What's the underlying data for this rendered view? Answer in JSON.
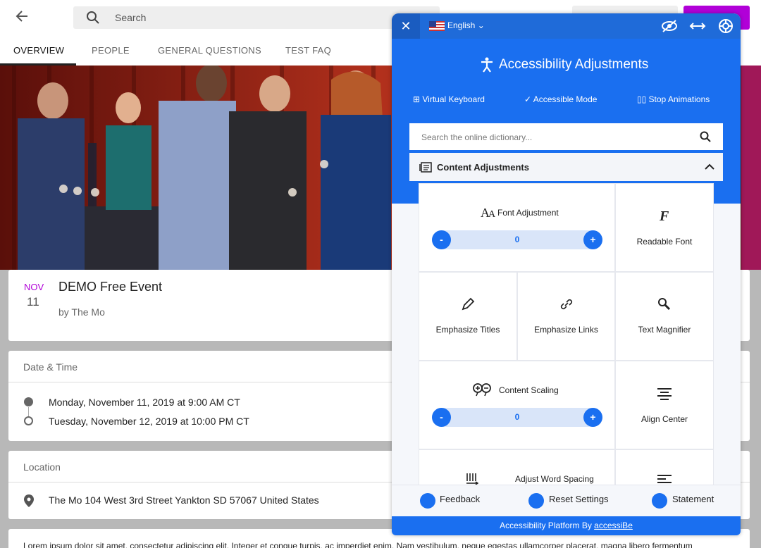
{
  "header": {
    "search_placeholder": "Search"
  },
  "tabs": [
    {
      "label": "OVERVIEW"
    },
    {
      "label": "PEOPLE"
    },
    {
      "label": "GENERAL QUESTIONS"
    },
    {
      "label": "TEST FAQ"
    }
  ],
  "event": {
    "month": "NOV",
    "day": "11",
    "title": "DEMO Free Event",
    "by": "by The Mo"
  },
  "date_time": {
    "heading": "Date & Time",
    "start": "Monday, November 11, 2019 at 9:00 AM CT",
    "end": "Tuesday, November 12, 2019 at 10:00 PM CT"
  },
  "location": {
    "heading": "Location",
    "address": "The Mo 104 West 3rd Street Yankton SD 57067 United States"
  },
  "description": {
    "text": "Lorem ipsum dolor sit amet, consectetur adipiscing elit. Integer et congue turpis, ac imperdiet enim. Nam vestibulum, neque egestas ullamcorper placerat, magna libero fermentum"
  },
  "accessibility": {
    "language": "English",
    "title": "Accessibility Adjustments",
    "modes": {
      "virtual_keyboard": "Virtual Keyboard",
      "accessible_mode": "Accessible Mode",
      "stop_animations": "Stop Animations"
    },
    "dictionary_placeholder": "Search the online dictionary...",
    "section_title": "Content Adjustments",
    "tiles": {
      "font_adjustment": "Font Adjustment",
      "font_value": "0",
      "readable_font": "Readable Font",
      "emphasize_titles": "Emphasize Titles",
      "emphasize_links": "Emphasize Links",
      "text_magnifier": "Text Magnifier",
      "content_scaling": "Content Scaling",
      "scaling_value": "0",
      "align_center": "Align Center",
      "word_spacing": "Adjust Word Spacing"
    },
    "stepper_minus": "-",
    "stepper_plus": "+",
    "footer": {
      "feedback": "Feedback",
      "reset": "Reset Settings",
      "statement": "Statement"
    },
    "credit_prefix": "Accessibility Platform By",
    "credit_link": "accessiBe"
  },
  "colors": {
    "brand_purple": "#b100d8",
    "panel_blue": "#1a6ff0"
  }
}
